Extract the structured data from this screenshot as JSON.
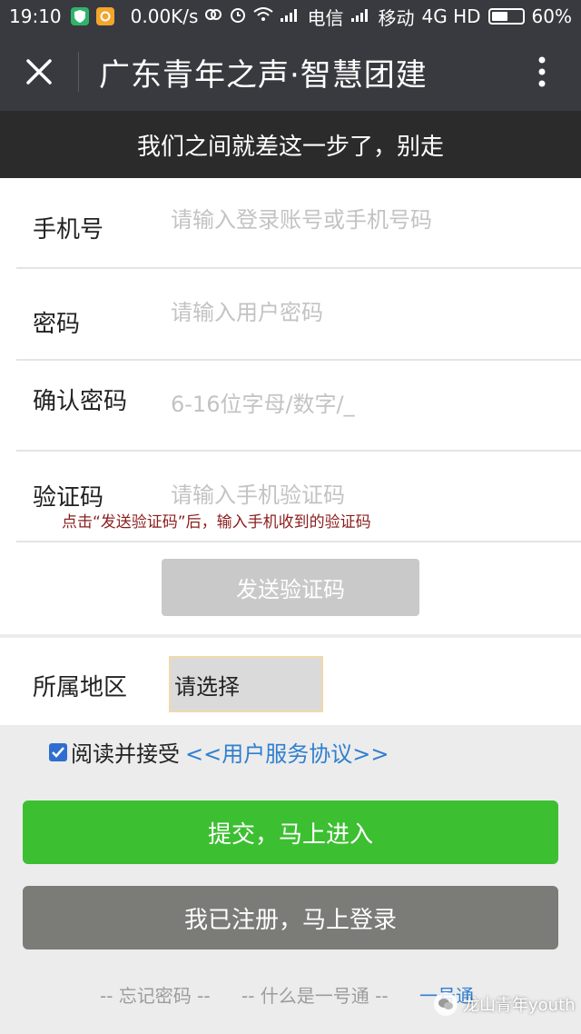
{
  "status_bar": {
    "time": "19:10",
    "speed": "0.00K/s",
    "carrier1": "电信",
    "carrier2": "移动",
    "network": "4G HD",
    "battery_percent": "60%",
    "battery_level": 0.6
  },
  "nav": {
    "title": "广东青年之声·智慧团建"
  },
  "banner": {
    "text": "我们之间就差这一步了，别走"
  },
  "form": {
    "phone": {
      "label": "手机号",
      "placeholder": "请输入登录账号或手机号码"
    },
    "password": {
      "label": "密码",
      "placeholder": "请输入用户密码"
    },
    "confirm": {
      "label": "确认密码",
      "placeholder": "6-16位字母/数字/_"
    },
    "code": {
      "label": "验证码",
      "placeholder": "请输入手机验证码"
    },
    "code_hint": "点击“发送验证码”后，输入手机收到的验证码",
    "send_code_label": "发送验证码",
    "region_label": "所属地区",
    "region_value": "请选择"
  },
  "agreement": {
    "text": "阅读并接受",
    "link": "<<用户服务协议>>",
    "checked": true
  },
  "buttons": {
    "submit": "提交，马上进入",
    "login": "我已注册，马上登录"
  },
  "footer": {
    "forgot": "-- 忘记密码 --",
    "what_is": "-- 什么是一号通 --",
    "link": "一号通"
  },
  "watermark": {
    "text": "龙山青年youth"
  }
}
